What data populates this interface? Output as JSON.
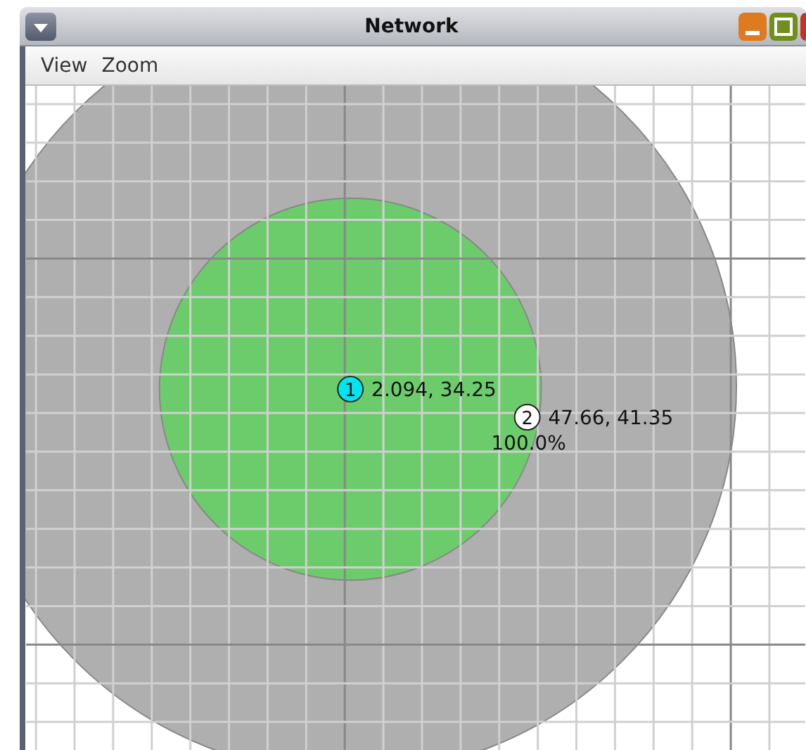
{
  "window": {
    "title": "Network"
  },
  "menu": [
    "View",
    "Zoom"
  ],
  "nodes": [
    {
      "number": "1",
      "coords": "2.094, 34.25",
      "color": "#00e5f0"
    },
    {
      "number": "2",
      "coords": "47.66, 41.35",
      "color": "#ffffff",
      "reading": "100.0%"
    }
  ]
}
